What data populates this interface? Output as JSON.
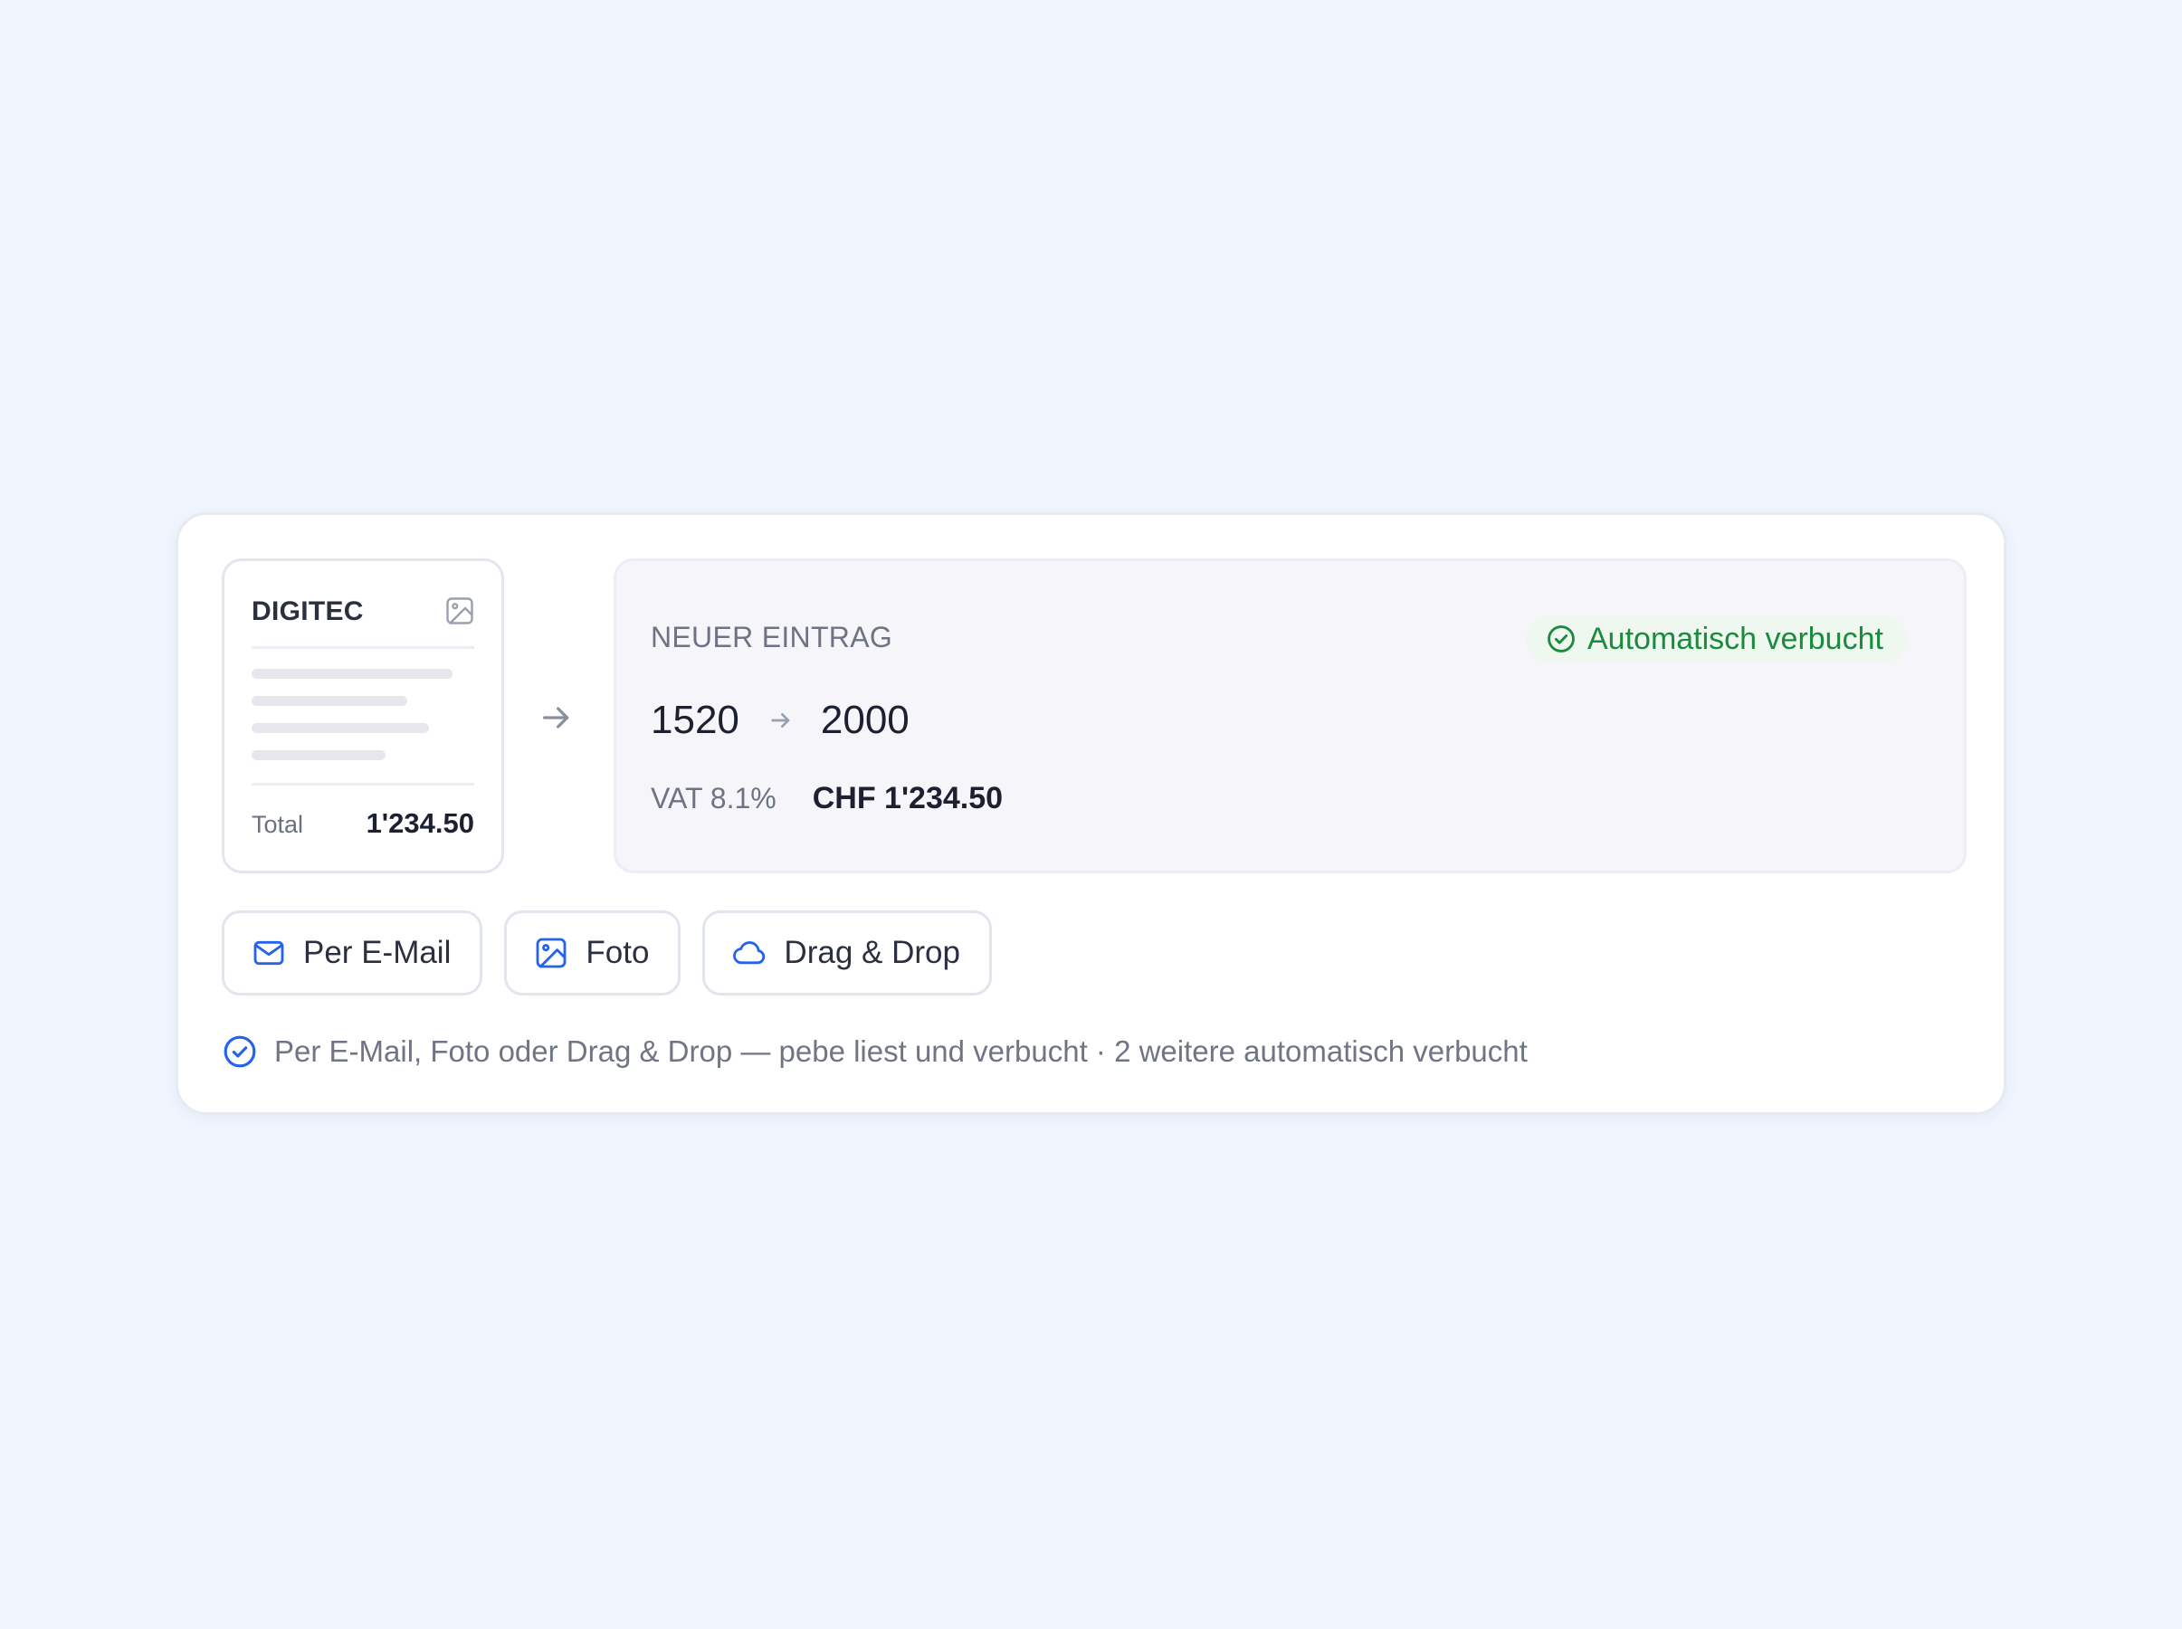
{
  "receipt": {
    "vendor": "DIGITEC",
    "image_icon": "image-icon",
    "total_label": "Total",
    "total_value": "1'234.50"
  },
  "flow_icon": "arrow-right-icon",
  "entry": {
    "label": "NEUER EINTRAG",
    "status": {
      "icon": "check-circle-icon",
      "text": "Automatisch verbucht",
      "color": "#1a8a3e",
      "background": "#eef8ef"
    },
    "debit_account": "1520",
    "credit_account": "2000",
    "vat_label": "VAT 8.1%",
    "amount": "CHF 1'234.50"
  },
  "upload_options": [
    {
      "icon": "mail-icon",
      "label": "Per E-Mail"
    },
    {
      "icon": "image-icon",
      "label": "Foto"
    },
    {
      "icon": "cloud-icon",
      "label": "Drag & Drop"
    }
  ],
  "footnote": {
    "icon": "check-circle-icon",
    "text": "Per E-Mail, Foto oder Drag & Drop — pebe liest und verbucht · 2 weitere automatisch verbucht"
  },
  "colors": {
    "accent": "#2563eb",
    "page_background": "#f0f5fe",
    "card_background": "#ffffff",
    "success": "#1a8a3e"
  }
}
